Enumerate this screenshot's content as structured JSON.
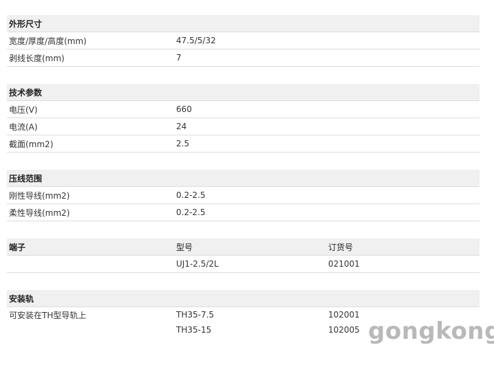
{
  "sections": {
    "dimensions": {
      "title": "外形尺寸",
      "rows": [
        {
          "label": "宽度/厚度/高度(mm)",
          "value": "47.5/5/32"
        },
        {
          "label": "剥线长度(mm)",
          "value": "7"
        }
      ]
    },
    "technical": {
      "title": "技术参数",
      "rows": [
        {
          "label": "电压(V)",
          "value": "660"
        },
        {
          "label": "电流(A)",
          "value": "24"
        },
        {
          "label": "截面(mm2)",
          "value": "2.5"
        }
      ]
    },
    "crimp": {
      "title": "压线范围",
      "rows": [
        {
          "label": "刚性导线(mm2)",
          "value": "0.2-2.5"
        },
        {
          "label": "柔性导线(mm2)",
          "value": "0.2-2.5"
        }
      ]
    },
    "terminal": {
      "title": "端子",
      "col2": "型号",
      "col3": "订货号",
      "rows": [
        {
          "label": "",
          "model": "UJ1-2.5/2L",
          "order": "021001"
        }
      ]
    },
    "rail": {
      "title": "安装轨",
      "rows": [
        {
          "label": "可安装在TH型导轨上",
          "model": "TH35-7.5",
          "order": "102001"
        },
        {
          "label": "",
          "model": "TH35-15",
          "order": "102005"
        }
      ]
    }
  },
  "watermark": "gongkong"
}
